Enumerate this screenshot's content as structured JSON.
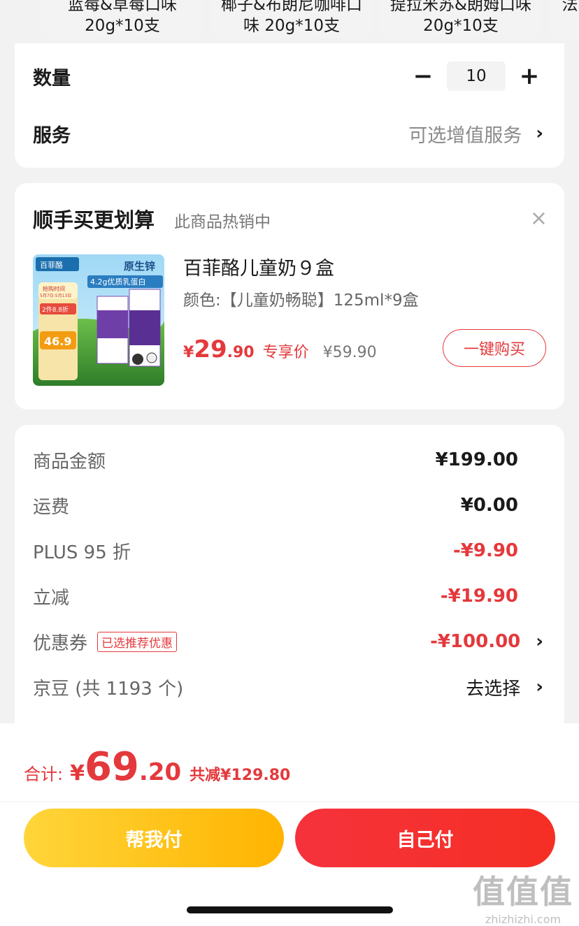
{
  "flavors": [
    {
      "line1": "蓝莓&草莓口味",
      "line2": "20g*10支"
    },
    {
      "line1": "椰子&布朗尼咖啡口",
      "line2": "味 20g*10支"
    },
    {
      "line1": "提拉米苏&朗姆口味",
      "line2": "20g*10支"
    },
    {
      "line1": "法",
      "line2": ""
    }
  ],
  "quantity": {
    "label": "数量",
    "minus": "−",
    "value": "10",
    "plus": "+"
  },
  "service": {
    "label": "服务",
    "value": "可选增值服务",
    "chevron": "›"
  },
  "bundle": {
    "title": "顺手买更划算",
    "subtitle": "此商品热销中",
    "close": "×",
    "product": {
      "name": "百菲酪儿童奶９盒",
      "spec": "颜色:【儿童奶畅聪】125ml*9盒",
      "price_currency": "¥",
      "price_int": "29",
      "price_dec": ".90",
      "price_tag": "专享价",
      "original_price": "¥59.90",
      "buy_label": "一键购买",
      "image_texts": {
        "brand": "百菲酪",
        "headline": "原生锌",
        "protein": "4.2g优质乳蛋白",
        "promo_time": "抢购时间",
        "promo_date": "5月7日-5月13日",
        "promo_discount": "2件8.8折",
        "promo_price": "46.9"
      }
    }
  },
  "summary": {
    "rows": [
      {
        "label": "商品金额",
        "value": "¥199.00",
        "red": false
      },
      {
        "label": "运费",
        "value": "¥0.00",
        "red": false
      },
      {
        "label": "PLUS 95 折",
        "value": "-¥9.90",
        "red": true
      },
      {
        "label": "立减",
        "value": "-¥19.90",
        "red": true
      }
    ],
    "coupon": {
      "label": "优惠券",
      "badge": "已选推荐优惠",
      "value": "-¥100.00",
      "chevron": "›"
    },
    "jingdou": {
      "label": "京豆 (共 1193 个)",
      "value": "去选择",
      "chevron": "›"
    }
  },
  "footer": {
    "total_label": "合计:",
    "total_currency": "¥",
    "total_int": "69",
    "total_dec": ".20",
    "saved": "共减¥129.80",
    "help_pay": "帮我付",
    "self_pay": "自己付"
  },
  "watermark": {
    "big": "值值值",
    "small": "zhizhizhi.com"
  },
  "colors": {
    "accent_red": "#e4393c",
    "help_pay_yellow": "#ffc21a",
    "self_pay_red": "#f53232"
  }
}
